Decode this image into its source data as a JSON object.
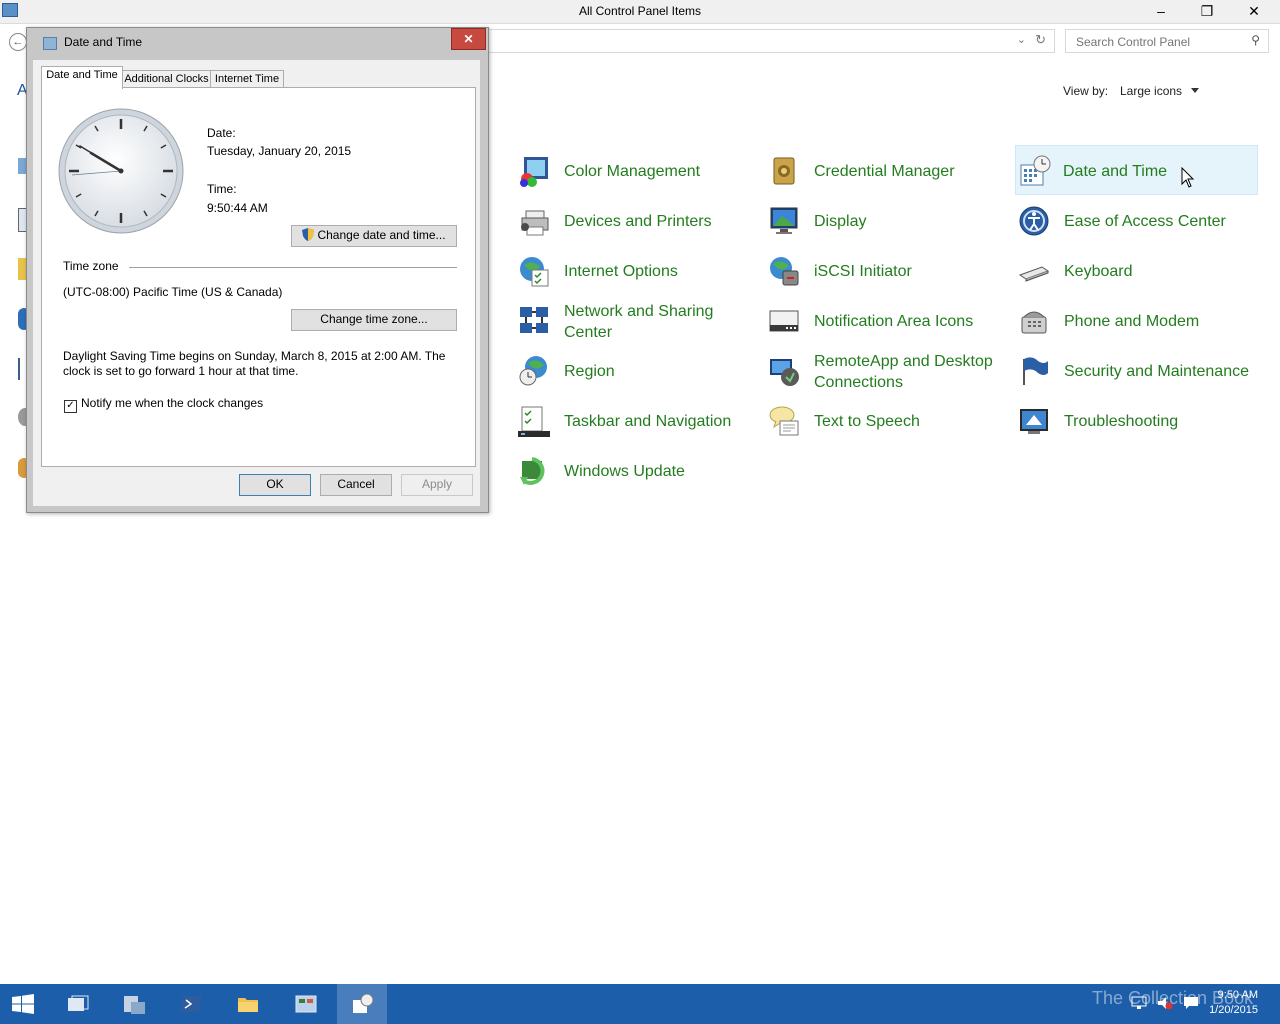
{
  "window": {
    "title": "All Control Panel Items",
    "minimize": "–",
    "restore": "❐",
    "close": "✕"
  },
  "search": {
    "placeholder": "Search Control Panel"
  },
  "view": {
    "label": "View by:",
    "value": "Large icons"
  },
  "left_peek_letter": "A",
  "items": [
    {
      "label": "Color Management",
      "icon": "color-management-icon"
    },
    {
      "label": "Credential Manager",
      "icon": "credential-manager-icon"
    },
    {
      "label": "Date and Time",
      "icon": "date-time-icon"
    },
    {
      "label": "Devices and Printers",
      "icon": "devices-printers-icon"
    },
    {
      "label": "Display",
      "icon": "display-icon"
    },
    {
      "label": "Ease of Access Center",
      "icon": "ease-of-access-icon"
    },
    {
      "label": "Internet Options",
      "icon": "internet-options-icon"
    },
    {
      "label": "iSCSI Initiator",
      "icon": "iscsi-icon"
    },
    {
      "label": "Keyboard",
      "icon": "keyboard-icon"
    },
    {
      "label": "Network and Sharing Center",
      "icon": "network-sharing-icon"
    },
    {
      "label": "Notification Area Icons",
      "icon": "notification-area-icon"
    },
    {
      "label": "Phone and Modem",
      "icon": "phone-modem-icon"
    },
    {
      "label": "Region",
      "icon": "region-icon"
    },
    {
      "label": "RemoteApp and Desktop Connections",
      "icon": "remoteapp-icon"
    },
    {
      "label": "Security and Maintenance",
      "icon": "security-maintenance-icon"
    },
    {
      "label": "Taskbar and Navigation",
      "icon": "taskbar-navigation-icon"
    },
    {
      "label": "Text to Speech",
      "icon": "text-to-speech-icon"
    },
    {
      "label": "Troubleshooting",
      "icon": "troubleshooting-icon"
    },
    {
      "label": "Windows Update",
      "icon": "windows-update-icon"
    }
  ],
  "dialog": {
    "title": "Date and Time",
    "close": "✕",
    "tabs": [
      "Date and Time",
      "Additional Clocks",
      "Internet Time"
    ],
    "date_label": "Date:",
    "date_value": "Tuesday, January 20, 2015",
    "time_label": "Time:",
    "time_value": "9:50:44 AM",
    "change_datetime_button": "Change date and time...",
    "timezone_heading": "Time zone",
    "timezone_value": "(UTC-08:00) Pacific Time (US & Canada)",
    "change_timezone_button": "Change time zone...",
    "dst_text_line1": "Daylight Saving Time begins on Sunday, March 8, 2015 at 2:00 AM. The",
    "dst_text_line2": "clock is set to go forward 1 hour at that time.",
    "notify_label": "Notify me when the clock changes",
    "notify_checked": true,
    "ok": "OK",
    "cancel": "Cancel",
    "apply": "Apply"
  },
  "taskbar": {
    "watermark": "The Collection Book",
    "clock_time": "9:50 AM",
    "clock_date": "1/20/2015"
  },
  "colors": {
    "link_green": "#237c1e",
    "taskbar_blue": "#1c5ea9",
    "dialog_close_red": "#c74a41"
  }
}
